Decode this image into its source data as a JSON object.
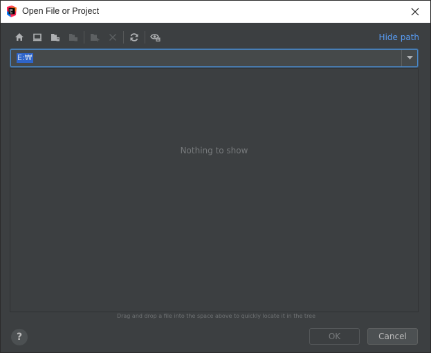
{
  "window": {
    "title": "Open File or Project"
  },
  "toolbar": {
    "buttons": [
      {
        "icon": "home-icon",
        "enabled": true
      },
      {
        "icon": "desktop-icon",
        "enabled": true
      },
      {
        "icon": "project-folder-icon",
        "enabled": true
      },
      {
        "icon": "module-folder-icon",
        "enabled": false
      },
      {
        "icon": "new-folder-icon",
        "enabled": false
      },
      {
        "icon": "delete-icon",
        "enabled": false
      },
      {
        "icon": "refresh-icon",
        "enabled": true
      },
      {
        "icon": "show-hidden-icon",
        "enabled": true
      }
    ],
    "hide_path_label": "Hide path"
  },
  "path": {
    "value": "E:₩"
  },
  "tree": {
    "empty_text": "Nothing to show"
  },
  "hint": "Drag and drop a file into the space above to quickly locate it in the tree",
  "footer": {
    "help_label": "?",
    "ok_label": "OK",
    "cancel_label": "Cancel"
  },
  "colors": {
    "accent": "#589df6",
    "selection": "#2f65ca",
    "background": "#3c3f41"
  }
}
